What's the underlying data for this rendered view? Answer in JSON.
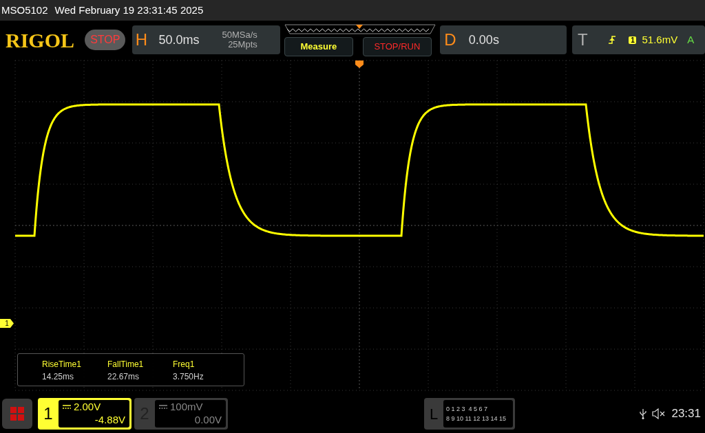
{
  "status_bar": {
    "model": "MSO5102",
    "datetime": "Wed February 19 23:31:45 2025"
  },
  "toolbar": {
    "logo": "RIGOL",
    "run_state": "STOP",
    "horizontal": {
      "label": "H",
      "timebase": "50.0ms",
      "sample_rate": "50MSa/s",
      "memory_depth": "25Mpts"
    },
    "buttons": [
      {
        "label": "Measure",
        "kind": "measure"
      },
      {
        "label": "STOP/RUN",
        "kind": "stoprun"
      }
    ],
    "delay": {
      "label": "D",
      "value": "0.00s"
    },
    "trigger": {
      "label": "T",
      "source": "1",
      "level": "51.6mV",
      "mode": "A"
    }
  },
  "waveform_area": {
    "channel_marker": "1"
  },
  "measurements": [
    {
      "name": "RiseTime1",
      "value": "14.25ms"
    },
    {
      "name": "FallTime1",
      "value": "22.67ms"
    },
    {
      "name": "Freq1",
      "value": "3.750Hz"
    }
  ],
  "channels": [
    {
      "number": "1",
      "scale": "2.00V",
      "offset": "-4.88V",
      "selected": true
    },
    {
      "number": "2",
      "scale": "100mV",
      "offset": "0.00V",
      "selected": false
    }
  ],
  "logic": {
    "label": "L",
    "row_1": "0 1 2 3  4 5 6 7",
    "row_2": "8 9 10 11 12 13 14 15"
  },
  "system_tray": {
    "time": "23:31"
  }
}
